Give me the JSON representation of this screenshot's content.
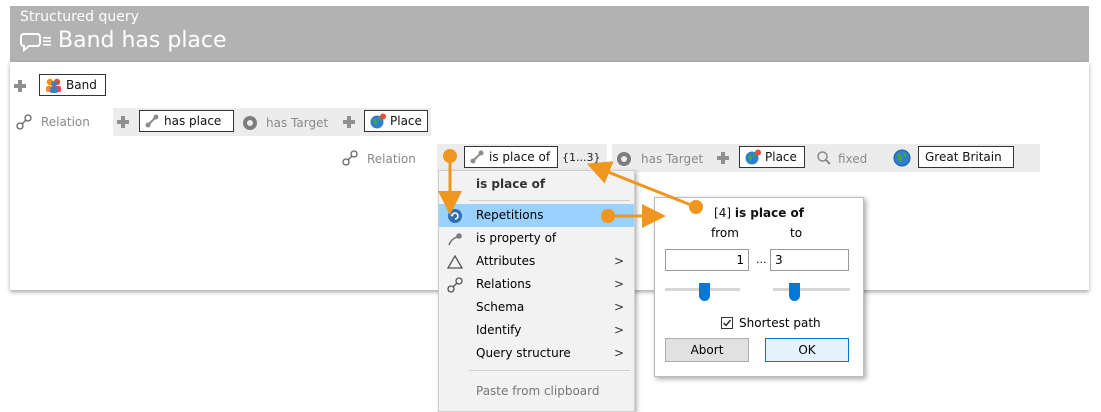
{
  "header": {
    "subtitle": "Structured query",
    "title": "Band has place"
  },
  "rows": {
    "band_label": "Band",
    "relation_label": "Relation",
    "has_place_label": "has place",
    "has_target_label": "has Target",
    "place_label": "Place",
    "relation2_label": "Relation",
    "is_place_of_label": "is place of",
    "range_label": "{1...3}",
    "has_target2_label": "has Target",
    "place2_label": "Place",
    "fixed_label": "fixed",
    "great_britain_label": "Great Britain"
  },
  "menu": {
    "header": "is place of",
    "items": [
      {
        "label": "Repetitions",
        "icon": "repetitions-icon",
        "submenu": false,
        "highlighted": true
      },
      {
        "label": "is property of",
        "icon": "property-icon",
        "submenu": false
      },
      {
        "label": "Attributes",
        "icon": "triangle-icon",
        "submenu": true
      },
      {
        "label": "Relations",
        "icon": "relation-icon",
        "submenu": true
      },
      {
        "label": "Schema",
        "icon": "",
        "submenu": true
      },
      {
        "label": "Identify",
        "icon": "",
        "submenu": true
      },
      {
        "label": "Query structure",
        "icon": "",
        "submenu": true
      }
    ],
    "paste": "Paste from clipboard",
    "arrow": ">"
  },
  "popup": {
    "title_prefix": "[4]",
    "title": "is place of",
    "from_label": "from",
    "to_label": "to",
    "from_value": "1",
    "ellipsis": "...",
    "to_value": "3",
    "shortest_path_label": "Shortest path",
    "shortest_path_checked": true,
    "abort_label": "Abort",
    "ok_label": "OK"
  },
  "colors": {
    "header_bg": "#b2b2b2",
    "highlight": "#99d1ff",
    "accent_orange": "#f0961e",
    "accent_blue": "#0078d7"
  }
}
